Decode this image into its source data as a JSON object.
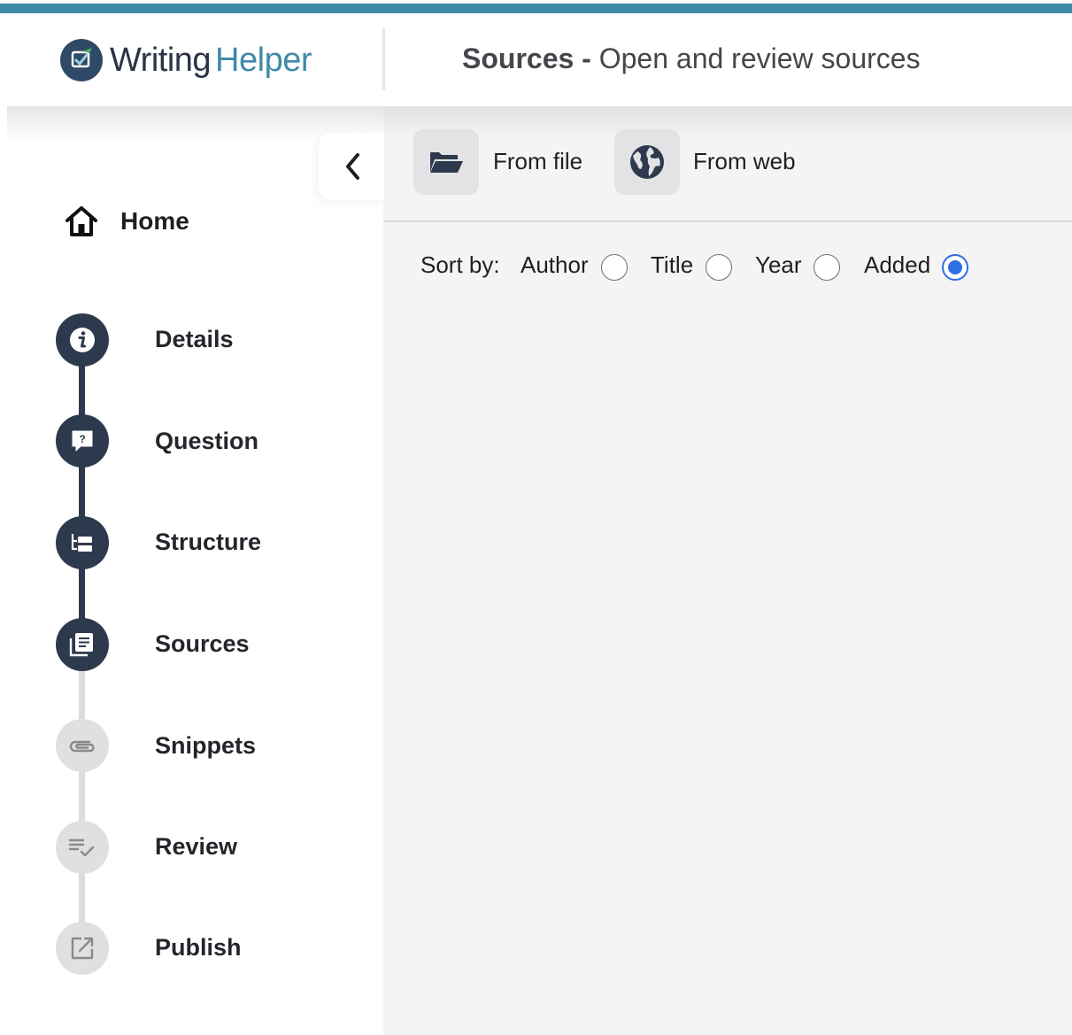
{
  "brand": {
    "name_part1": "Writing",
    "name_part2": "Helper",
    "accent": "#3f8aa9",
    "dark": "#2d3a4d"
  },
  "header": {
    "title_bold": "Sources -",
    "title_rest": "Open and review sources"
  },
  "sidebar": {
    "collapse_icon": "chevron-left-icon",
    "home": {
      "label": "Home",
      "icon": "home-icon"
    },
    "steps": [
      {
        "label": "Details",
        "icon": "info-icon",
        "state": "done"
      },
      {
        "label": "Question",
        "icon": "question-bubble-icon",
        "state": "done"
      },
      {
        "label": "Structure",
        "icon": "structure-icon",
        "state": "done"
      },
      {
        "label": "Sources",
        "icon": "sources-icon",
        "state": "current"
      },
      {
        "label": "Snippets",
        "icon": "paperclip-icon",
        "state": "todo"
      },
      {
        "label": "Review",
        "icon": "review-check-icon",
        "state": "todo"
      },
      {
        "label": "Publish",
        "icon": "external-link-icon",
        "state": "todo"
      }
    ]
  },
  "toolbar": {
    "from_file": {
      "label": "From file",
      "icon": "folder-open-icon"
    },
    "from_web": {
      "label": "From web",
      "icon": "globe-icon"
    }
  },
  "sort": {
    "label": "Sort by:",
    "options": [
      "Author",
      "Title",
      "Year",
      "Added"
    ],
    "selected": "Added"
  }
}
